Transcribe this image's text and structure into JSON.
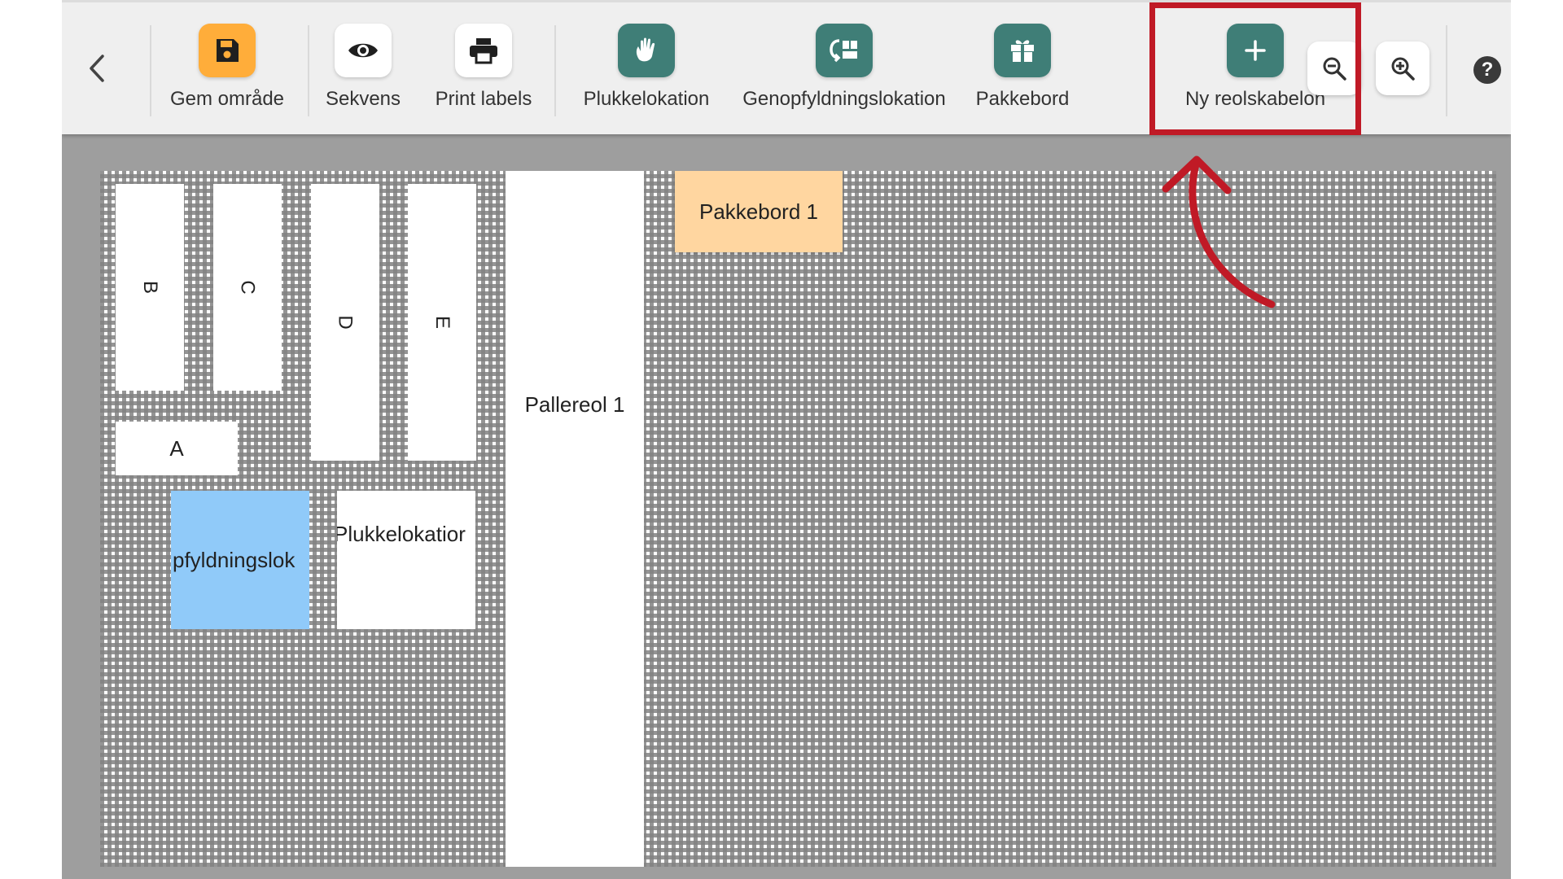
{
  "toolbar": {
    "save_label": "Gem område",
    "sequence_label": "Sekvens",
    "print_label": "Print labels",
    "pick_location_label": "Plukkelokation",
    "replenish_location_label": "Genopfyldningslokation",
    "packing_table_label": "Pakkebord",
    "new_shelf_template_label": "Ny reolskabelon",
    "help_label": "?"
  },
  "icons": {
    "back": "chevron-left-icon",
    "save": "floppy-disk-icon",
    "sequence": "eye-icon",
    "print": "printer-icon",
    "pick_location": "hand-icon",
    "replenish_location": "refill-icon",
    "packing_table": "gift-box-icon",
    "new_shelf_template": "plus-icon",
    "zoom_out": "zoom-out-icon",
    "zoom_in": "zoom-in-icon",
    "help": "question-icon"
  },
  "colors": {
    "save_button": "#ffad3a",
    "teal_buttons": "#3f7e77",
    "highlight": "#c01a26",
    "packing_table_fill": "#ffd6a0",
    "replenish_fill": "#90caf9"
  },
  "canvas": {
    "shelf_b": "B",
    "shelf_c": "C",
    "shelf_d": "D",
    "shelf_e": "E",
    "shelf_a": "A",
    "pallet_rack": "Pallereol 1",
    "packing_table": "Pakkebord 1",
    "replenish_location": "pfyldningslok",
    "pick_location": "Plukkelokatior"
  }
}
